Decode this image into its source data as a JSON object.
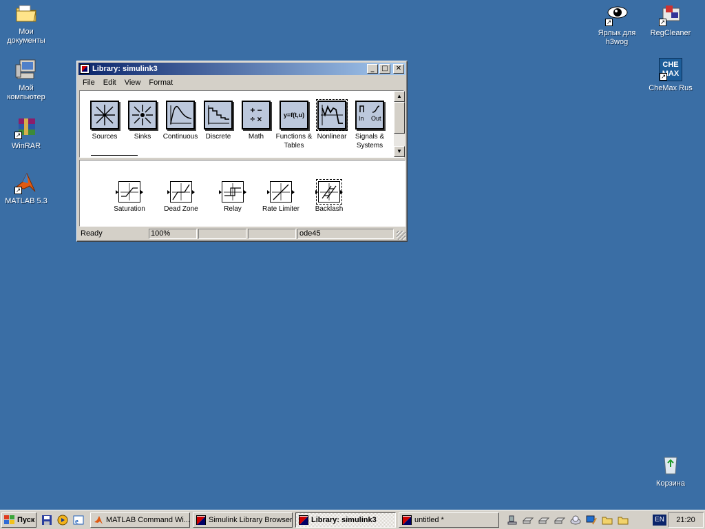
{
  "desktop": {
    "icons_left": [
      {
        "label": "Мои документы",
        "icon": "my-documents-folder"
      },
      {
        "label": "Мой компьютер",
        "icon": "my-computer"
      },
      {
        "label": "WinRAR",
        "icon": "winrar-archive"
      },
      {
        "label": "MATLAB 5.3",
        "icon": "matlab-logo"
      }
    ],
    "icons_right": [
      {
        "label": "Ярлык для h3wog",
        "icon": "eye"
      },
      {
        "label": "RegCleaner",
        "icon": "regcleaner"
      },
      {
        "label": "CheMax Rus",
        "icon": "chemax"
      },
      {
        "label": "Корзина",
        "icon": "recycle-bin"
      }
    ],
    "chemax_icon_text": "CHE MAX",
    "background_color": "#3a6ea5"
  },
  "window": {
    "title": "Library: simulink3",
    "controls": {
      "minimize": "_",
      "maximize": "□",
      "close": "✕"
    },
    "menu": [
      "File",
      "Edit",
      "View",
      "Format"
    ],
    "libraries": [
      {
        "label": "Sources",
        "icon": "sources"
      },
      {
        "label": "Sinks",
        "icon": "sinks"
      },
      {
        "label": "Continuous",
        "icon": "continuous"
      },
      {
        "label": "Discrete",
        "icon": "discrete"
      },
      {
        "label": "Math",
        "icon": "math"
      },
      {
        "label": "Functions & Tables",
        "icon": "functions-tables"
      },
      {
        "label": "Nonlinear",
        "icon": "nonlinear",
        "selected": true
      },
      {
        "label": "Signals & Systems",
        "icon": "signals-systems"
      }
    ],
    "functions_icon_text": "y=f(t,u)",
    "signals_icon_text": {
      "in": "In",
      "out": "Out"
    },
    "math_icon_text": "+ −\n÷ ×",
    "blocks": [
      {
        "label": "Saturation",
        "icon": "saturation"
      },
      {
        "label": "Dead Zone",
        "icon": "dead-zone"
      },
      {
        "label": "Relay",
        "icon": "relay"
      },
      {
        "label": "Rate Limiter",
        "icon": "rate-limiter"
      },
      {
        "label": "Backlash",
        "icon": "backlash",
        "selected": true
      }
    ],
    "status": {
      "text": "Ready",
      "zoom": "100%",
      "empty1": "",
      "empty2": "",
      "solver": "ode45"
    },
    "scroll": {
      "up": "▲",
      "down": "▼"
    }
  },
  "taskbar": {
    "start_label": "Пуск",
    "quick_launch": [
      "save-icon",
      "media-player-icon",
      "ie-icon"
    ],
    "tasks": [
      {
        "label": "MATLAB Command Wi...",
        "icon": "matlab-icon",
        "active": false
      },
      {
        "label": "Simulink Library Browser",
        "icon": "simulink-icon",
        "active": false
      },
      {
        "label": "Library: simulink3",
        "icon": "simulink-icon",
        "active": true
      },
      {
        "label": "untitled *",
        "icon": "simulink-icon",
        "active": false
      }
    ],
    "tray_icons": [
      "network-icon",
      "drive-icon",
      "drive-icon",
      "drive-icon",
      "cd-icon",
      "display-icon",
      "folder-icon",
      "folder-icon"
    ],
    "language": "EN",
    "clock": "21:20"
  }
}
